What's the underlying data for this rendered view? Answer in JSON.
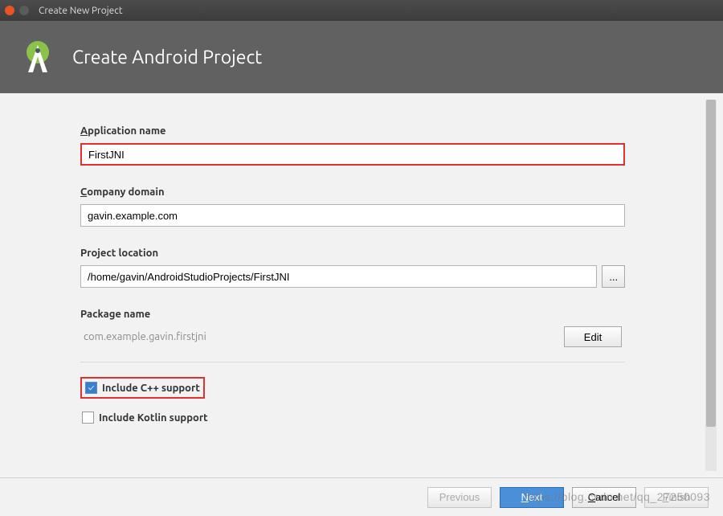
{
  "window": {
    "title": "Create New Project"
  },
  "header": {
    "title": "Create Android Project"
  },
  "fields": {
    "app_name": {
      "label_pre": "A",
      "label_rest": "pplication name",
      "value": "FirstJNI"
    },
    "company": {
      "label_pre": "C",
      "label_rest": "ompany domain",
      "value": "gavin.example.com"
    },
    "location": {
      "label": "Project location",
      "value": "/home/gavin/AndroidStudioProjects/FirstJNI",
      "browse": "..."
    },
    "package": {
      "label": "Package name",
      "value": "com.example.gavin.firstjni",
      "edit": "Edit"
    }
  },
  "options": {
    "cpp": {
      "label": "Include C++ support",
      "checked": true
    },
    "kotlin": {
      "label": "Include Kotlin support",
      "checked": false
    }
  },
  "footer": {
    "previous": "Previous",
    "next_pre": "N",
    "next_rest": "ext",
    "cancel_pre": "C",
    "cancel_rest": "ancel",
    "finish_pre": "F",
    "finish_rest": "inish"
  },
  "watermark": "https://blog.csdn.net/qq_27250093"
}
